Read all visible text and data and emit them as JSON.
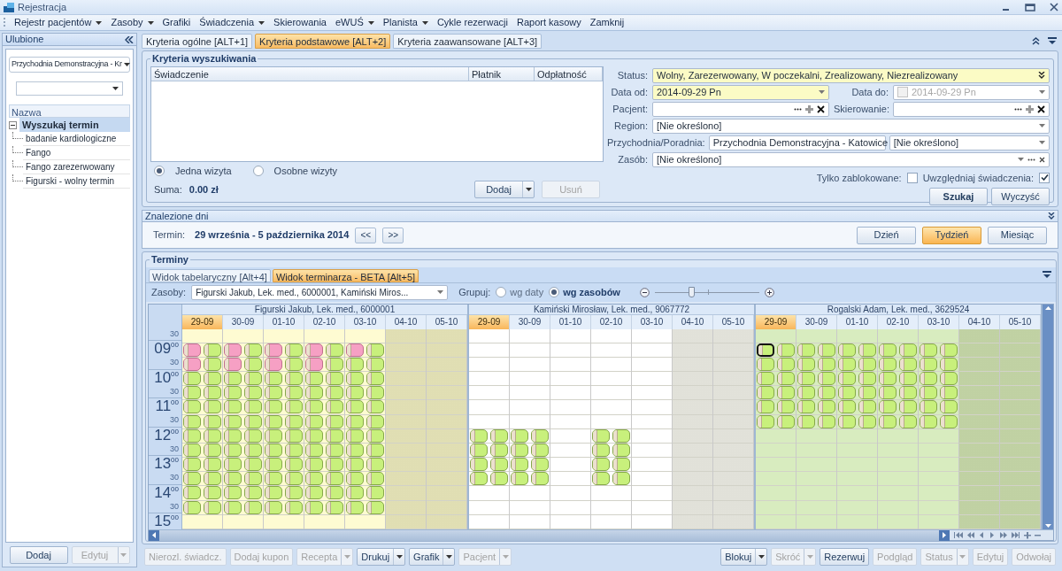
{
  "window": {
    "title": "Rejestracja"
  },
  "menu": [
    {
      "label": "Rejestr pacjentów",
      "dropdown": true
    },
    {
      "label": "Zasoby",
      "dropdown": true
    },
    {
      "label": "Grafiki",
      "dropdown": false
    },
    {
      "label": "Świadczenia",
      "dropdown": true
    },
    {
      "label": "Skierowania",
      "dropdown": false
    },
    {
      "label": "eWUŚ",
      "dropdown": true
    },
    {
      "label": "Planista",
      "dropdown": true
    },
    {
      "label": "Cykle rezerwacji",
      "dropdown": false
    },
    {
      "label": "Raport kasowy",
      "dropdown": false
    },
    {
      "label": "Zamknij",
      "dropdown": false
    }
  ],
  "sidebar": {
    "title": "Ulubione",
    "clinic_value": "Przychodnia Demonstracyjna - Kr",
    "tree_column": "Nazwa",
    "tree": [
      {
        "label": "Wyszukaj termin",
        "expanded": true,
        "selected": true,
        "children": [
          {
            "label": "badanie kardiologiczne",
            "selected": false
          },
          {
            "label": "Fango",
            "selected": false
          },
          {
            "label": "Fango zarezerwowany",
            "selected": false
          },
          {
            "label": "Figurski - wolny termin",
            "selected": false
          }
        ]
      }
    ],
    "buttons": [
      {
        "label": "Dodaj",
        "disabled": false,
        "split": false
      },
      {
        "label": "Edytuj",
        "disabled": true,
        "split": true
      }
    ]
  },
  "criteria_tabs": [
    {
      "label": "Kryteria ogólne [ALT+1]",
      "selected": false
    },
    {
      "label": "Kryteria podstawowe [ALT+2]",
      "selected": true
    },
    {
      "label": "Kryteria zaawansowane [ALT+3]",
      "selected": false
    }
  ],
  "criteria": {
    "title": "Kryteria wyszukiwania",
    "columns": [
      "Świadczenie",
      "Płatnik",
      "Odpłatność"
    ],
    "visit_mode": [
      {
        "label": "Jedna wizyta",
        "selected": true
      },
      {
        "label": "Osobne wizyty",
        "selected": false
      }
    ],
    "sum_label": "Suma:",
    "sum_value": "0.00 zł",
    "buttons": [
      {
        "label": "Dodaj",
        "disabled": false,
        "split": true
      },
      {
        "label": "Usuń",
        "disabled": true,
        "split": false
      }
    ],
    "status": {
      "label": "Status:",
      "value": "Wolny, Zarezerwowany, W poczekalni, Zrealizowany, Niezrealizowany",
      "highlighted": true
    },
    "date_from": {
      "label": "Data od:",
      "value": "2014-09-29 Pn",
      "highlighted": true
    },
    "date_to": {
      "label": "Data do:",
      "value": "2014-09-29 Pn",
      "checked": false,
      "disabled": true
    },
    "patient": {
      "label": "Pacjent:"
    },
    "referral": {
      "label": "Skierowanie:"
    },
    "region": {
      "label": "Region:",
      "value": "[Nie określono]"
    },
    "clinic": {
      "label": "Przychodnia/Poradnia:",
      "value": "Przychodnia Demonstracyjna - Katowice",
      "unit": "[Nie określono]"
    },
    "resource": {
      "label": "Zasób:",
      "value": "[Nie określono]"
    },
    "only_blocked": {
      "label": "Tylko zablokowane:",
      "checked": false
    },
    "include_services": {
      "label": "Uwzględniaj świadczenia:",
      "checked": true
    },
    "actions": [
      {
        "label": "Szukaj",
        "default": true
      },
      {
        "label": "Wyczyść",
        "default": false
      }
    ]
  },
  "found_days": {
    "title": "Znalezione dni",
    "term_label": "Termin:",
    "term_value": "29 września - 5 października 2014",
    "nav": [
      "<<",
      ">>"
    ],
    "views": [
      {
        "label": "Dzień",
        "selected": false
      },
      {
        "label": "Tydzień",
        "selected": true
      },
      {
        "label": "Miesiąc",
        "selected": false
      }
    ]
  },
  "schedule": {
    "title": "Terminy",
    "tabs": [
      {
        "label": "Widok tabelaryczny [Alt+4]",
        "selected": false
      },
      {
        "label": "Widok terminarza - BETA [Alt+5]",
        "selected": true
      }
    ],
    "resources_label": "Zasoby:",
    "resources_value": "Figurski Jakub, Lek. med., 6000001, Kamiński Miros...",
    "group_label": "Grupuj:",
    "group_options": [
      {
        "label": "wg daty",
        "selected": false
      },
      {
        "label": "wg zasobów",
        "selected": true
      }
    ],
    "zoom": {
      "level": 0.35
    },
    "time_rows": [
      {
        "kind": "half",
        "minute": "30"
      },
      {
        "kind": "hour",
        "hour": "09",
        "minute": "00"
      },
      {
        "kind": "half",
        "minute": "30"
      },
      {
        "kind": "hour",
        "hour": "10",
        "minute": "00"
      },
      {
        "kind": "half",
        "minute": "30"
      },
      {
        "kind": "hour",
        "hour": "11",
        "minute": "00"
      },
      {
        "kind": "half",
        "minute": "30"
      },
      {
        "kind": "hour",
        "hour": "12",
        "minute": "00"
      },
      {
        "kind": "half",
        "minute": "30"
      },
      {
        "kind": "hour",
        "hour": "13",
        "minute": "00"
      },
      {
        "kind": "half",
        "minute": "30"
      },
      {
        "kind": "hour",
        "hour": "14",
        "minute": "00"
      },
      {
        "kind": "half",
        "minute": "30"
      },
      {
        "kind": "hour",
        "hour": "15",
        "minute": "00"
      }
    ],
    "resources": [
      {
        "name": "Figurski Jakub, Lek. med., 6000001",
        "color": "#fefbd2",
        "days": [
          {
            "label": "29-09",
            "selected": true,
            "closed": false,
            "slots": [
              {
                "kind": "empty"
              },
              {
                "kind": "slots",
                "reserved": true,
                "selected": false
              },
              {
                "kind": "slots",
                "reserved": true,
                "selected": false
              },
              {
                "kind": "slots",
                "reserved": false,
                "selected": false
              },
              {
                "kind": "slots",
                "reserved": false,
                "selected": false
              },
              {
                "kind": "slots",
                "reserved": false,
                "selected": false
              },
              {
                "kind": "slots",
                "reserved": false,
                "selected": false
              },
              {
                "kind": "slots",
                "reserved": false,
                "selected": false
              },
              {
                "kind": "slots",
                "reserved": false,
                "selected": false
              },
              {
                "kind": "slots",
                "reserved": false,
                "selected": false
              },
              {
                "kind": "slots",
                "reserved": false,
                "selected": false
              },
              {
                "kind": "slots",
                "reserved": false,
                "selected": false
              },
              {
                "kind": "slots",
                "reserved": false,
                "selected": false
              },
              {
                "kind": "empty"
              }
            ]
          },
          {
            "label": "30-09",
            "selected": false,
            "closed": false,
            "slots": [
              {
                "kind": "empty"
              },
              {
                "kind": "slots",
                "reserved": true,
                "selected": false
              },
              {
                "kind": "slots",
                "reserved": true,
                "selected": false
              },
              {
                "kind": "slots",
                "reserved": false,
                "selected": false
              },
              {
                "kind": "slots",
                "reserved": false,
                "selected": false
              },
              {
                "kind": "slots",
                "reserved": false,
                "selected": false
              },
              {
                "kind": "slots",
                "reserved": false,
                "selected": false
              },
              {
                "kind": "slots",
                "reserved": false,
                "selected": false
              },
              {
                "kind": "slots",
                "reserved": false,
                "selected": false
              },
              {
                "kind": "slots",
                "reserved": false,
                "selected": false
              },
              {
                "kind": "slots",
                "reserved": false,
                "selected": false
              },
              {
                "kind": "slots",
                "reserved": false,
                "selected": false
              },
              {
                "kind": "slots",
                "reserved": false,
                "selected": false
              },
              {
                "kind": "empty"
              }
            ]
          },
          {
            "label": "01-10",
            "selected": false,
            "closed": false,
            "slots": [
              {
                "kind": "empty"
              },
              {
                "kind": "slots",
                "reserved": true,
                "selected": false
              },
              {
                "kind": "slots",
                "reserved": true,
                "selected": false
              },
              {
                "kind": "slots",
                "reserved": false,
                "selected": false
              },
              {
                "kind": "slots",
                "reserved": false,
                "selected": false
              },
              {
                "kind": "slots",
                "reserved": false,
                "selected": false
              },
              {
                "kind": "slots",
                "reserved": false,
                "selected": false
              },
              {
                "kind": "slots",
                "reserved": false,
                "selected": false
              },
              {
                "kind": "slots",
                "reserved": false,
                "selected": false
              },
              {
                "kind": "slots",
                "reserved": false,
                "selected": false
              },
              {
                "kind": "slots",
                "reserved": false,
                "selected": false
              },
              {
                "kind": "slots",
                "reserved": false,
                "selected": false
              },
              {
                "kind": "slots",
                "reserved": false,
                "selected": false
              },
              {
                "kind": "empty"
              }
            ]
          },
          {
            "label": "02-10",
            "selected": false,
            "closed": false,
            "slots": [
              {
                "kind": "empty"
              },
              {
                "kind": "slots",
                "reserved": true,
                "selected": false
              },
              {
                "kind": "slots",
                "reserved": true,
                "selected": false
              },
              {
                "kind": "slots",
                "reserved": false,
                "selected": false
              },
              {
                "kind": "slots",
                "reserved": false,
                "selected": false
              },
              {
                "kind": "slots",
                "reserved": false,
                "selected": false
              },
              {
                "kind": "slots",
                "reserved": false,
                "selected": false
              },
              {
                "kind": "slots",
                "reserved": false,
                "selected": false
              },
              {
                "kind": "slots",
                "reserved": false,
                "selected": false
              },
              {
                "kind": "slots",
                "reserved": false,
                "selected": false
              },
              {
                "kind": "slots",
                "reserved": false,
                "selected": false
              },
              {
                "kind": "slots",
                "reserved": false,
                "selected": false
              },
              {
                "kind": "slots",
                "reserved": false,
                "selected": false
              },
              {
                "kind": "empty"
              }
            ]
          },
          {
            "label": "03-10",
            "selected": false,
            "closed": false,
            "slots": [
              {
                "kind": "empty"
              },
              {
                "kind": "slots",
                "reserved": true,
                "selected": false
              },
              {
                "kind": "slots",
                "reserved": false,
                "selected": false
              },
              {
                "kind": "slots",
                "reserved": false,
                "selected": false
              },
              {
                "kind": "slots",
                "reserved": false,
                "selected": false
              },
              {
                "kind": "slots",
                "reserved": false,
                "selected": false
              },
              {
                "kind": "slots",
                "reserved": false,
                "selected": false
              },
              {
                "kind": "slots",
                "reserved": false,
                "selected": false
              },
              {
                "kind": "slots",
                "reserved": false,
                "selected": false
              },
              {
                "kind": "slots",
                "reserved": false,
                "selected": false
              },
              {
                "kind": "slots",
                "reserved": false,
                "selected": false
              },
              {
                "kind": "slots",
                "reserved": false,
                "selected": false
              },
              {
                "kind": "slots",
                "reserved": false,
                "selected": false
              },
              {
                "kind": "empty"
              }
            ]
          },
          {
            "label": "04-10",
            "selected": false,
            "closed": true
          },
          {
            "label": "05-10",
            "selected": false,
            "closed": true
          }
        ]
      },
      {
        "name": "Kamiński Mirosław, Lek. med., 9067772",
        "color": "#ffffff",
        "days": [
          {
            "label": "29-09",
            "selected": true,
            "closed": false,
            "slots": [
              {
                "kind": "empty"
              },
              {
                "kind": "empty"
              },
              {
                "kind": "empty"
              },
              {
                "kind": "empty"
              },
              {
                "kind": "empty"
              },
              {
                "kind": "empty"
              },
              {
                "kind": "empty"
              },
              {
                "kind": "slots",
                "reserved": false,
                "selected": false
              },
              {
                "kind": "slots",
                "reserved": false,
                "selected": false
              },
              {
                "kind": "slots",
                "reserved": false,
                "selected": false
              },
              {
                "kind": "slots",
                "reserved": false,
                "selected": false
              },
              {
                "kind": "empty"
              },
              {
                "kind": "empty"
              },
              {
                "kind": "empty"
              }
            ]
          },
          {
            "label": "30-09",
            "selected": false,
            "closed": false,
            "slots": [
              {
                "kind": "empty"
              },
              {
                "kind": "empty"
              },
              {
                "kind": "empty"
              },
              {
                "kind": "empty"
              },
              {
                "kind": "empty"
              },
              {
                "kind": "empty"
              },
              {
                "kind": "empty"
              },
              {
                "kind": "slots",
                "reserved": false,
                "selected": false
              },
              {
                "kind": "slots",
                "reserved": false,
                "selected": false
              },
              {
                "kind": "slots",
                "reserved": false,
                "selected": false
              },
              {
                "kind": "slots",
                "reserved": false,
                "selected": false
              },
              {
                "kind": "empty"
              },
              {
                "kind": "empty"
              },
              {
                "kind": "empty"
              }
            ]
          },
          {
            "label": "01-10",
            "selected": false,
            "closed": false
          },
          {
            "label": "02-10",
            "selected": false,
            "closed": false,
            "slots": [
              {
                "kind": "empty"
              },
              {
                "kind": "empty"
              },
              {
                "kind": "empty"
              },
              {
                "kind": "empty"
              },
              {
                "kind": "empty"
              },
              {
                "kind": "empty"
              },
              {
                "kind": "empty"
              },
              {
                "kind": "slots",
                "reserved": false,
                "selected": false
              },
              {
                "kind": "slots",
                "reserved": false,
                "selected": false
              },
              {
                "kind": "slots",
                "reserved": false,
                "selected": false
              },
              {
                "kind": "slots",
                "reserved": false,
                "selected": false
              },
              {
                "kind": "empty"
              },
              {
                "kind": "empty"
              },
              {
                "kind": "empty"
              }
            ]
          },
          {
            "label": "03-10",
            "selected": false,
            "closed": false
          },
          {
            "label": "04-10",
            "selected": false,
            "closed": true
          },
          {
            "label": "05-10",
            "selected": false,
            "closed": true
          }
        ]
      },
      {
        "name": "Rogalski Adam, Lek. med., 3629524",
        "color": "#d8ecbf",
        "days": [
          {
            "label": "29-09",
            "selected": true,
            "closed": false,
            "slots": [
              {
                "kind": "empty"
              },
              {
                "kind": "slots",
                "reserved": false,
                "selected": true
              },
              {
                "kind": "slots",
                "reserved": false,
                "selected": false
              },
              {
                "kind": "slots",
                "reserved": false,
                "selected": false
              },
              {
                "kind": "slots",
                "reserved": false,
                "selected": false
              },
              {
                "kind": "slots",
                "reserved": false,
                "selected": false
              },
              {
                "kind": "slots",
                "reserved": false,
                "selected": false
              },
              {
                "kind": "empty"
              },
              {
                "kind": "empty"
              },
              {
                "kind": "empty"
              },
              {
                "kind": "empty"
              },
              {
                "kind": "empty"
              },
              {
                "kind": "empty"
              },
              {
                "kind": "empty"
              }
            ]
          },
          {
            "label": "30-09",
            "selected": false,
            "closed": false,
            "slots": [
              {
                "kind": "empty"
              },
              {
                "kind": "slots",
                "reserved": false,
                "selected": false
              },
              {
                "kind": "slots",
                "reserved": false,
                "selected": false
              },
              {
                "kind": "slots",
                "reserved": false,
                "selected": false
              },
              {
                "kind": "slots",
                "reserved": false,
                "selected": false
              },
              {
                "kind": "slots",
                "reserved": false,
                "selected": false
              },
              {
                "kind": "slots",
                "reserved": false,
                "selected": false
              },
              {
                "kind": "empty"
              },
              {
                "kind": "empty"
              },
              {
                "kind": "empty"
              },
              {
                "kind": "empty"
              },
              {
                "kind": "empty"
              },
              {
                "kind": "empty"
              },
              {
                "kind": "empty"
              }
            ]
          },
          {
            "label": "01-10",
            "selected": false,
            "closed": false,
            "slots": [
              {
                "kind": "empty"
              },
              {
                "kind": "slots",
                "reserved": false,
                "selected": false
              },
              {
                "kind": "slots",
                "reserved": false,
                "selected": false
              },
              {
                "kind": "slots",
                "reserved": false,
                "selected": false
              },
              {
                "kind": "slots",
                "reserved": false,
                "selected": false
              },
              {
                "kind": "slots",
                "reserved": false,
                "selected": false
              },
              {
                "kind": "slots",
                "reserved": false,
                "selected": false
              },
              {
                "kind": "empty"
              },
              {
                "kind": "empty"
              },
              {
                "kind": "empty"
              },
              {
                "kind": "empty"
              },
              {
                "kind": "empty"
              },
              {
                "kind": "empty"
              },
              {
                "kind": "empty"
              }
            ]
          },
          {
            "label": "02-10",
            "selected": false,
            "closed": false,
            "slots": [
              {
                "kind": "empty"
              },
              {
                "kind": "slots",
                "reserved": false,
                "selected": false
              },
              {
                "kind": "slots",
                "reserved": false,
                "selected": false
              },
              {
                "kind": "slots",
                "reserved": false,
                "selected": false
              },
              {
                "kind": "slots",
                "reserved": false,
                "selected": false
              },
              {
                "kind": "slots",
                "reserved": false,
                "selected": false
              },
              {
                "kind": "slots",
                "reserved": false,
                "selected": false
              },
              {
                "kind": "empty"
              },
              {
                "kind": "empty"
              },
              {
                "kind": "empty"
              },
              {
                "kind": "empty"
              },
              {
                "kind": "empty"
              },
              {
                "kind": "empty"
              },
              {
                "kind": "empty"
              }
            ]
          },
          {
            "label": "03-10",
            "selected": false,
            "closed": false,
            "slots": [
              {
                "kind": "empty"
              },
              {
                "kind": "slots",
                "reserved": false,
                "selected": false
              },
              {
                "kind": "slots",
                "reserved": false,
                "selected": false
              },
              {
                "kind": "slots",
                "reserved": false,
                "selected": false
              },
              {
                "kind": "slots",
                "reserved": false,
                "selected": false
              },
              {
                "kind": "slots",
                "reserved": false,
                "selected": false
              },
              {
                "kind": "slots",
                "reserved": false,
                "selected": false
              },
              {
                "kind": "empty"
              },
              {
                "kind": "empty"
              },
              {
                "kind": "empty"
              },
              {
                "kind": "empty"
              },
              {
                "kind": "empty"
              },
              {
                "kind": "empty"
              },
              {
                "kind": "empty"
              }
            ]
          },
          {
            "label": "04-10",
            "selected": false,
            "closed": true
          },
          {
            "label": "05-10",
            "selected": false,
            "closed": true
          }
        ]
      }
    ]
  },
  "toolbar_left": [
    {
      "label": "Nierozl. świadcz.",
      "disabled": true,
      "split": false
    },
    {
      "label": "Dodaj kupon",
      "disabled": true,
      "split": false
    },
    {
      "label": "Recepta",
      "disabled": true,
      "split": true
    },
    {
      "label": "Drukuj",
      "disabled": false,
      "split": true
    },
    {
      "label": "Grafik",
      "disabled": false,
      "split": true
    },
    {
      "label": "Pacjent",
      "disabled": true,
      "split": true
    }
  ],
  "toolbar_right": [
    {
      "label": "Blokuj",
      "disabled": false,
      "split": true
    },
    {
      "label": "Skróć",
      "disabled": true,
      "split": true
    },
    {
      "label": "Rezerwuj",
      "disabled": false,
      "split": false
    },
    {
      "label": "Podgląd",
      "disabled": true,
      "split": false
    },
    {
      "label": "Status",
      "disabled": true,
      "split": true
    },
    {
      "label": "Edytuj",
      "disabled": true,
      "split": false
    },
    {
      "label": "Odwołaj",
      "disabled": true,
      "split": false
    }
  ]
}
